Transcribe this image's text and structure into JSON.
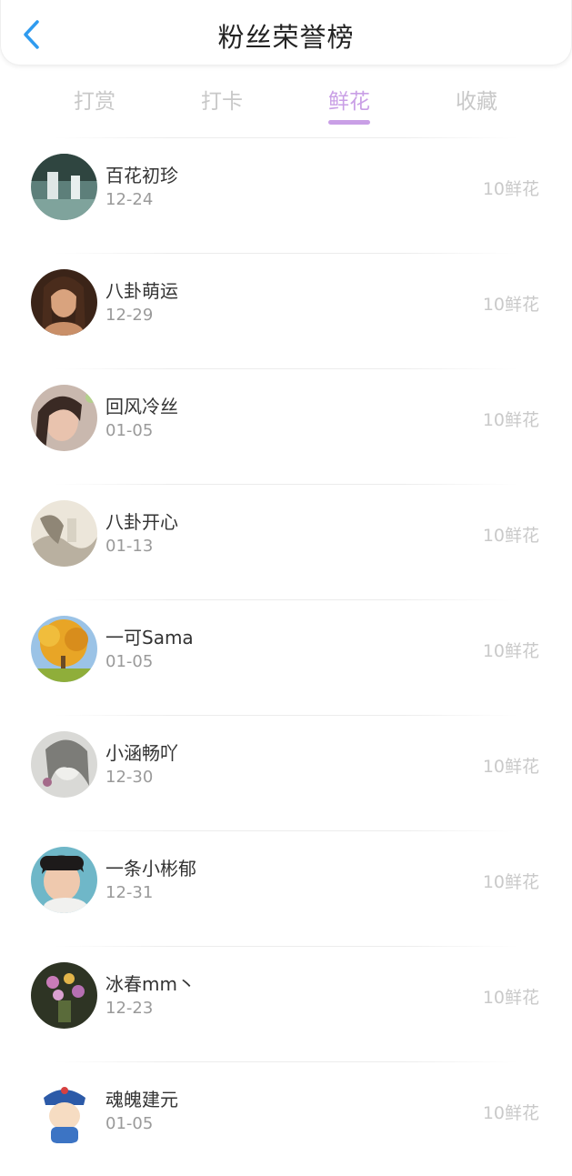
{
  "header": {
    "title": "粉丝荣誉榜",
    "back_icon": "chevron-left-icon"
  },
  "colors": {
    "accent": "#c99fe6",
    "back": "#2f9bef",
    "tab_inactive": "#c8c8c8",
    "amount": "#c9c9c9"
  },
  "tabs": [
    {
      "label": "打赏"
    },
    {
      "label": "打卡"
    },
    {
      "label": "鲜花"
    },
    {
      "label": "收藏"
    }
  ],
  "active_tab": "鲜花",
  "fans": [
    {
      "name": "百花初珍",
      "date": "12-24",
      "amount": "10鲜花",
      "avatar": "landscape-avatar"
    },
    {
      "name": "八卦萌运",
      "date": "12-29",
      "amount": "10鲜花",
      "avatar": "portrait-avatar"
    },
    {
      "name": "回风冷丝",
      "date": "01-05",
      "amount": "10鲜花",
      "avatar": "portrait-avatar"
    },
    {
      "name": "八卦开心",
      "date": "01-13",
      "amount": "10鲜花",
      "avatar": "ink-painting-avatar"
    },
    {
      "name": "一可Sama",
      "date": "01-05",
      "amount": "10鲜花",
      "avatar": "autumn-tree-avatar"
    },
    {
      "name": "小涵畅吖",
      "date": "12-30",
      "amount": "10鲜花",
      "avatar": "sketch-avatar"
    },
    {
      "name": "一条小彬郁",
      "date": "12-31",
      "amount": "10鲜花",
      "avatar": "boy-avatar"
    },
    {
      "name": "冰春mm丶",
      "date": "12-23",
      "amount": "10鲜花",
      "avatar": "flowers-avatar"
    },
    {
      "name": "魂魄建元",
      "date": "01-05",
      "amount": "10鲜花",
      "avatar": "cartoon-avatar"
    }
  ]
}
